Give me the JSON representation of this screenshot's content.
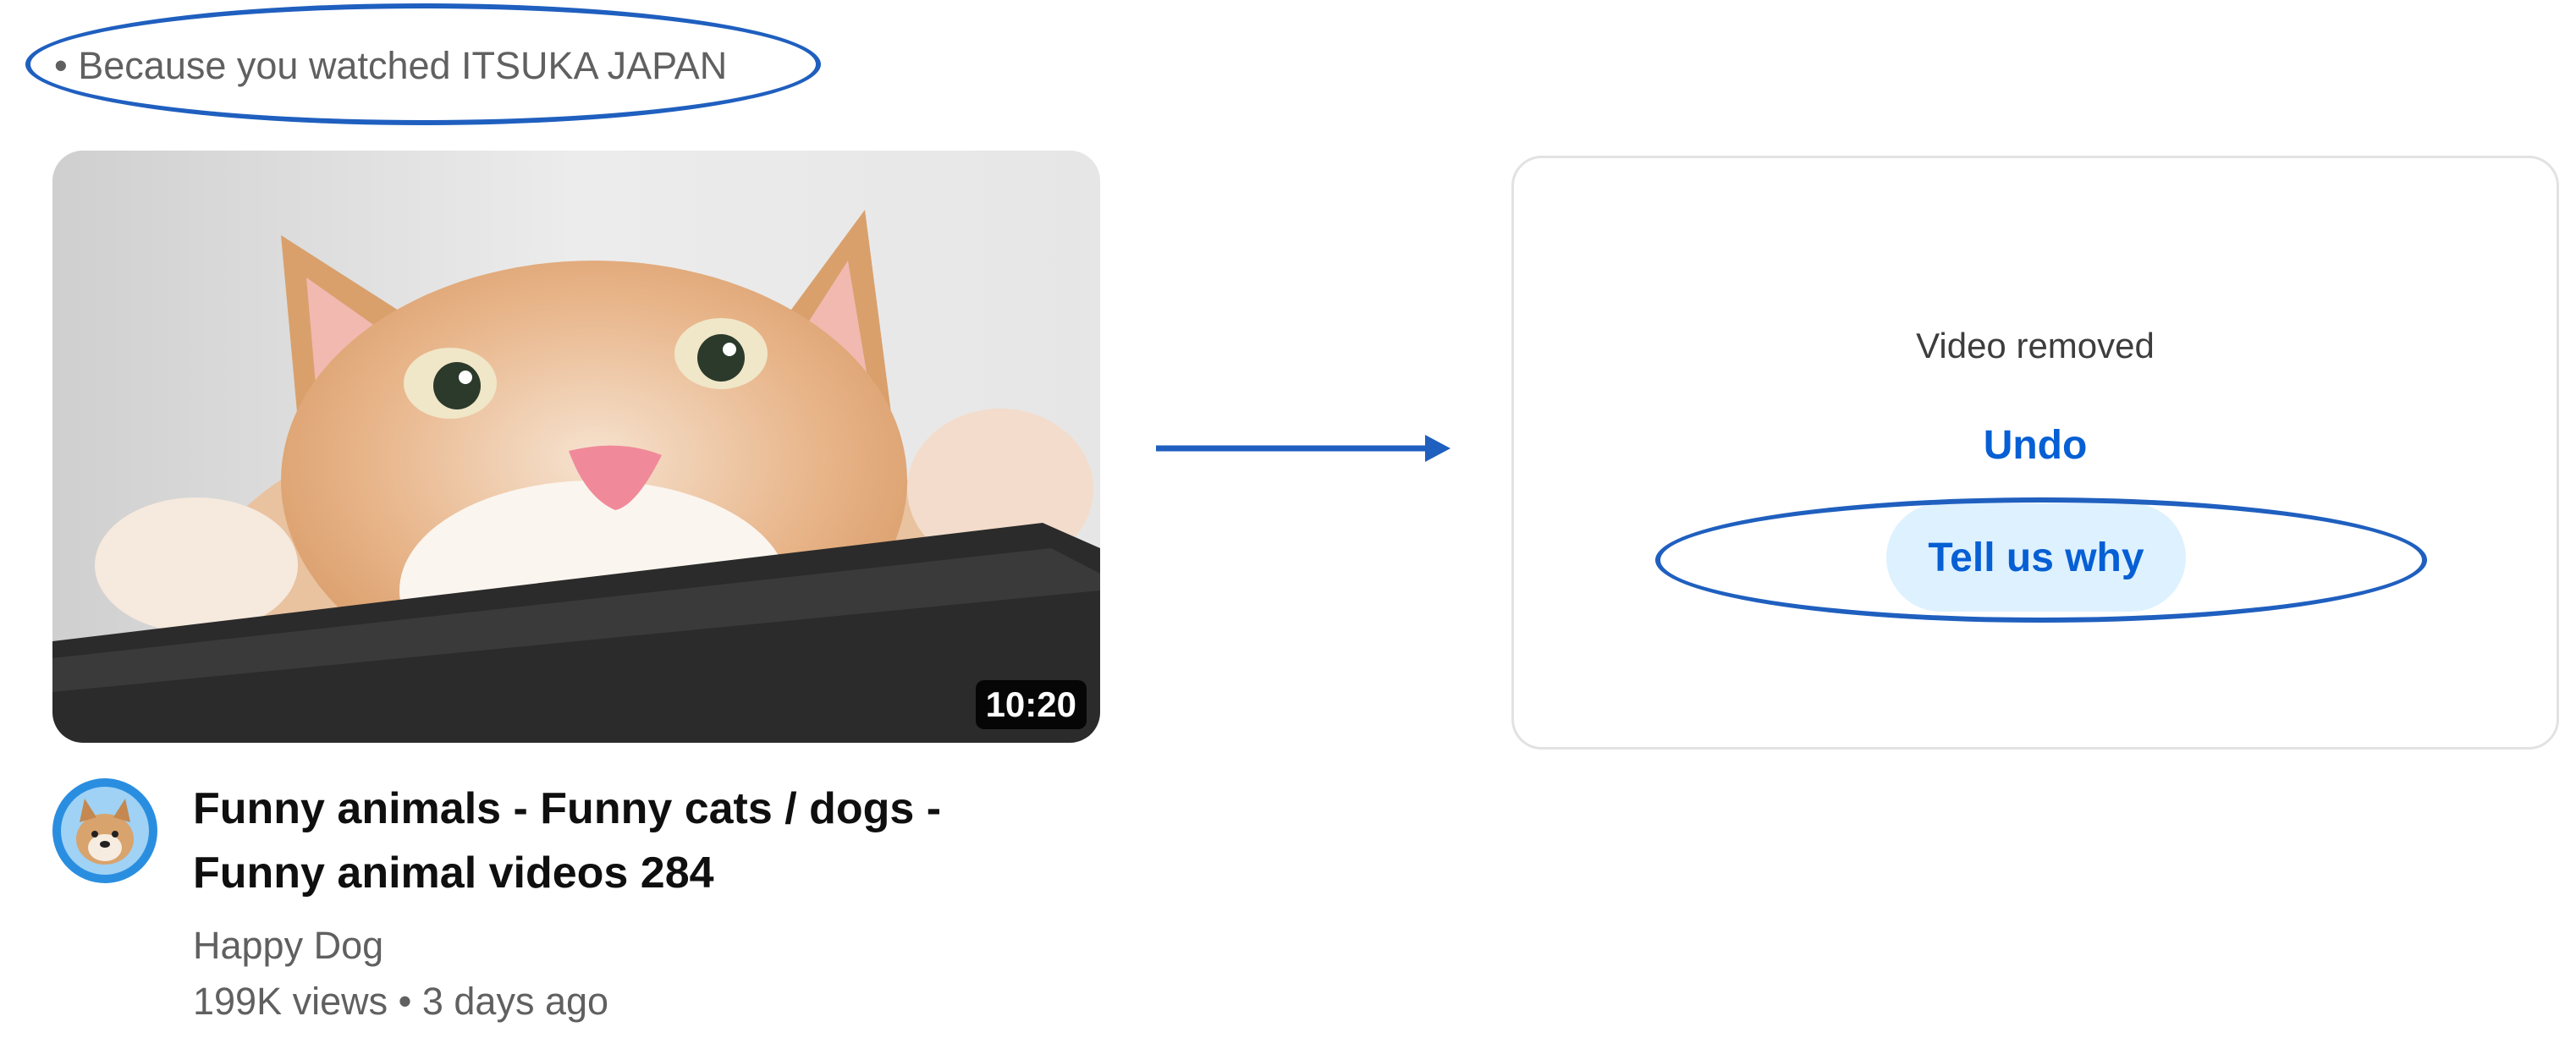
{
  "recommendation": {
    "reason_text": "• Because you watched ITSUKA JAPAN"
  },
  "video": {
    "thumbnail_subject": "orange-white cat peeking over a dark ledge",
    "duration": "10:20",
    "title": "Funny animals - Funny cats / dogs - Funny animal videos 284",
    "channel": "Happy Dog",
    "meta": "199K views • 3 days ago",
    "avatar_icon": "dog-avatar-icon"
  },
  "removed_state": {
    "status_text": "Video removed",
    "undo_label": "Undo",
    "feedback_label": "Tell us why"
  },
  "annotations": {
    "highlight_color": "#1f5fbf",
    "arrow_icon": "right-arrow-icon"
  },
  "colors": {
    "link_blue": "#065fd4",
    "feedback_bg": "#def1ff",
    "secondary_text": "#606060"
  }
}
